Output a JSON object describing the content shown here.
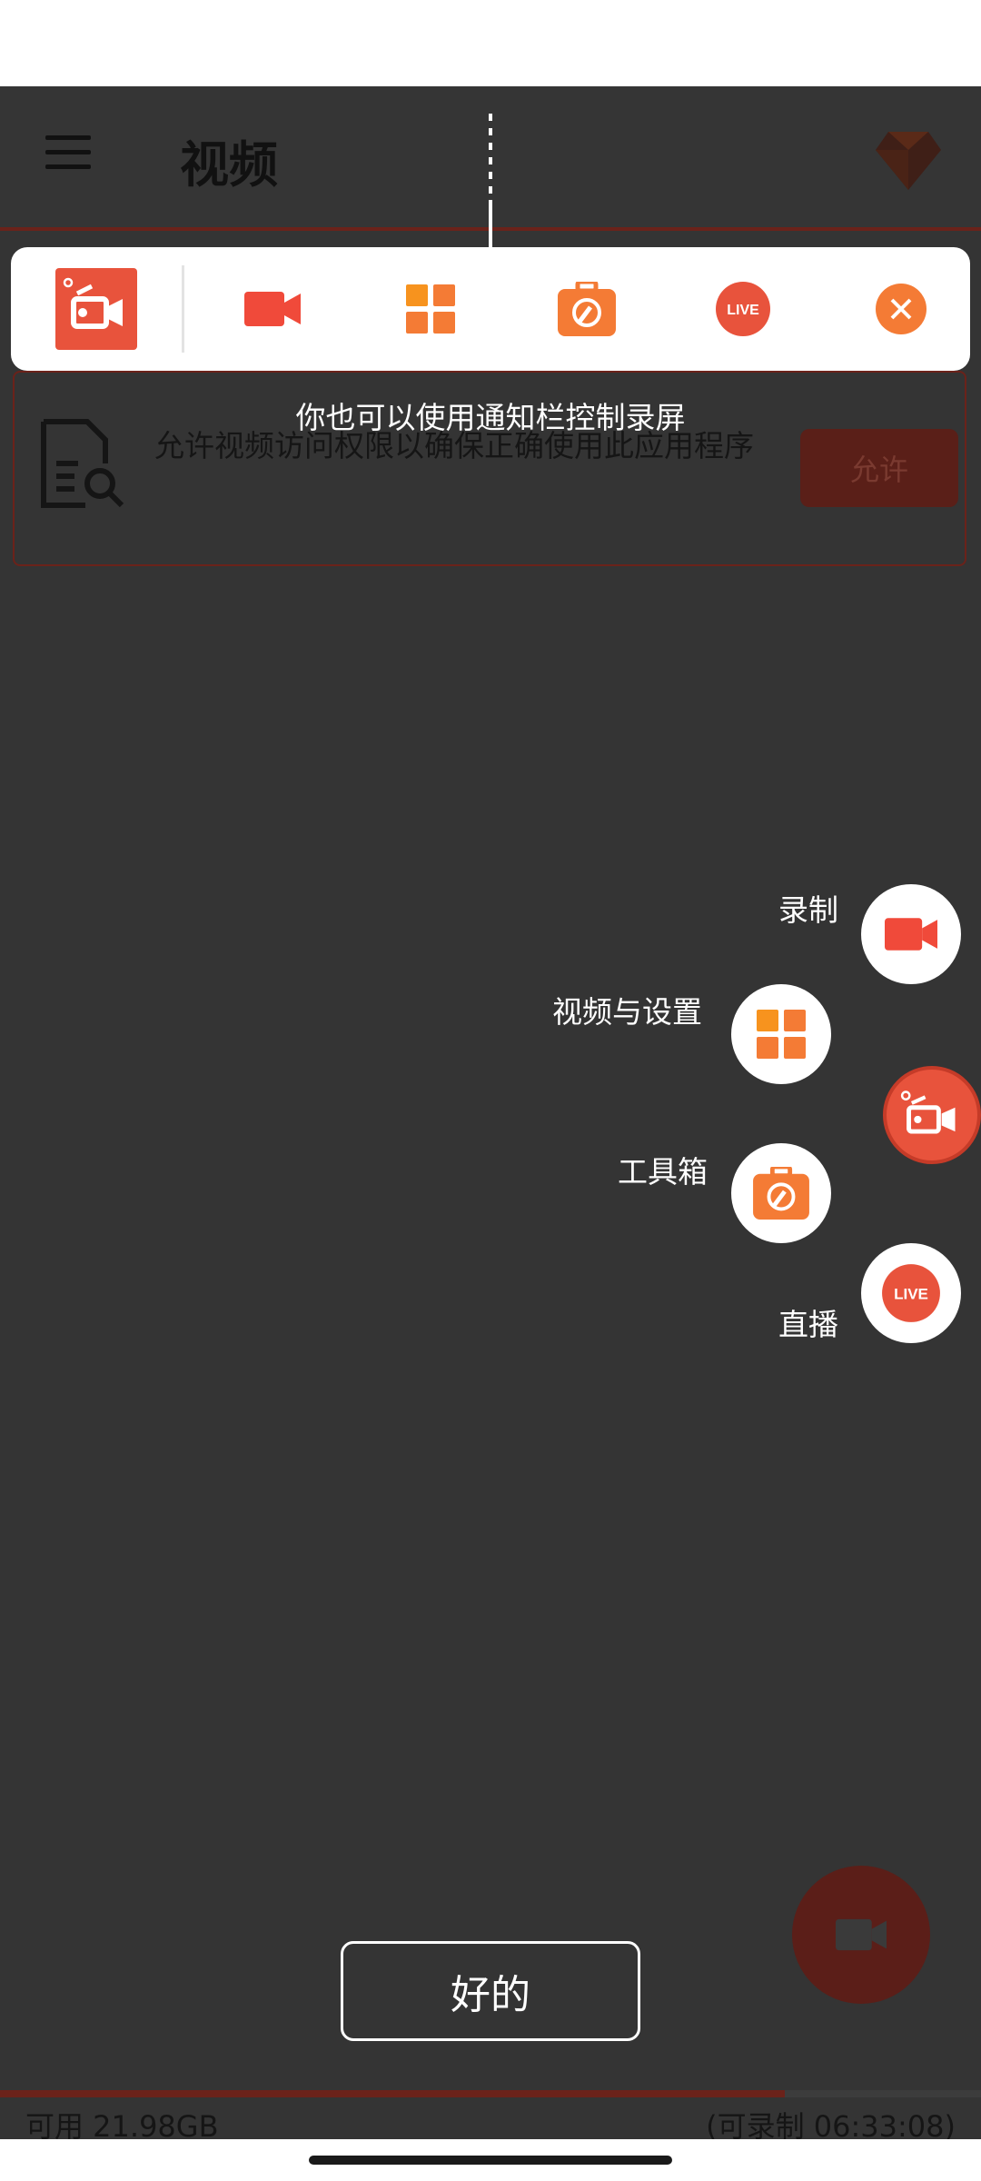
{
  "header": {
    "title": "视频"
  },
  "notification_panel": {
    "icons": [
      "app-logo-icon",
      "record-video-icon",
      "grid-icon",
      "toolbox-icon",
      "live-icon",
      "close-icon"
    ],
    "live_label": "LIVE"
  },
  "hint": {
    "text": "你也可以使用通知栏控制录屏"
  },
  "permission_card": {
    "message": "允许视频访问权限以确保正确使用此应用程序",
    "button_label": "允许"
  },
  "fab_menu": {
    "items": [
      {
        "label": "录制",
        "icon": "record-video-icon"
      },
      {
        "label": "视频与设置",
        "icon": "grid-icon"
      },
      {
        "label": "工具箱",
        "icon": "toolbox-icon"
      },
      {
        "label": "直播",
        "icon": "live-icon"
      }
    ],
    "live_label": "LIVE"
  },
  "ok_button": {
    "label": "好的"
  },
  "storage": {
    "available": "可用 21.98GB",
    "recordable": "(可录制 06:33:08)",
    "used_fraction": 0.8
  },
  "colors": {
    "accent": "#e8533c",
    "background": "#343434",
    "orange": "#f47b35"
  }
}
